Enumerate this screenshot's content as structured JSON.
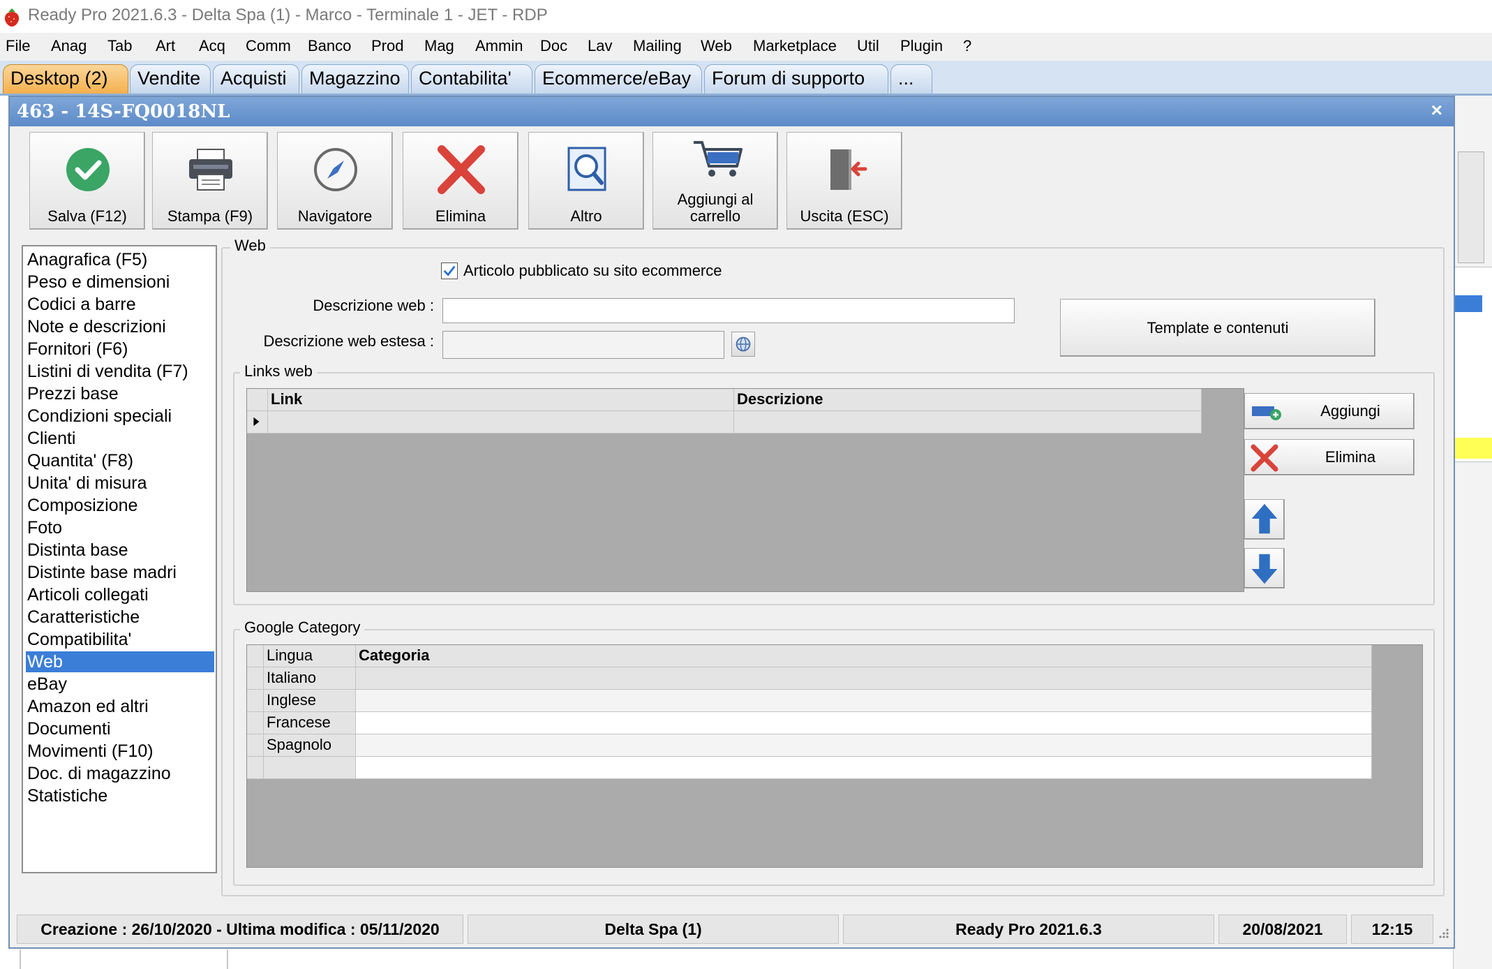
{
  "window_title": "Ready Pro 2021.6.3 - Delta Spa (1) - Marco - Terminale 1 - JET - RDP",
  "menu": [
    "File",
    "Anag",
    "Tab",
    "Art",
    "Acq",
    "Comm",
    "Banco",
    "Prod",
    "Mag",
    "Ammin",
    "Doc",
    "Lav",
    "Mailing",
    "Web",
    "Marketplace",
    "Util",
    "Plugin",
    "?"
  ],
  "tabs": [
    {
      "label": "Desktop (2)",
      "active": true
    },
    {
      "label": "Vendite"
    },
    {
      "label": "Acquisti"
    },
    {
      "label": "Magazzino"
    },
    {
      "label": "Contabilita'"
    },
    {
      "label": "Ecommerce/eBay"
    },
    {
      "label": "Forum di supporto"
    },
    {
      "label": "..."
    }
  ],
  "dialog": {
    "title": "463 - 14S-FQ0018NL",
    "close": "×"
  },
  "toolbar": {
    "save": "Salva (F12)",
    "print": "Stampa (F9)",
    "navigator": "Navigatore",
    "delete": "Elimina",
    "other": "Altro",
    "add_cart_1": "Aggiungi al",
    "add_cart_2": "carrello",
    "exit": "Uscita (ESC)"
  },
  "nav": {
    "items": [
      "Anagrafica (F5)",
      "Peso e dimensioni",
      "Codici a barre",
      "Note e descrizioni",
      "Fornitori (F6)",
      "Listini di vendita (F7)",
      "Prezzi base",
      "Condizioni speciali",
      "Clienti",
      "Quantita' (F8)",
      "Unita' di misura",
      "Composizione",
      "Foto",
      "Distinta base",
      "Distinte base madri",
      "Articoli collegati",
      "Caratteristiche",
      "Compatibilita'",
      "Web",
      "eBay",
      "Amazon ed altri",
      "Documenti",
      "Movimenti (F10)",
      "Doc. di magazzino",
      "Statistiche"
    ],
    "selected": "Web"
  },
  "web": {
    "group_label": "Web",
    "published_label": "Articolo pubblicato su sito ecommerce",
    "published_checked": true,
    "desc_label": "Descrizione web :",
    "desc_value": "",
    "desc_ext_label": "Descrizione web estesa :",
    "desc_ext_value": "",
    "template_button": "Template e contenuti"
  },
  "links": {
    "group_label": "Links web",
    "col_link": "Link",
    "col_desc": "Descrizione",
    "add_button": "Aggiungi",
    "delete_button": "Elimina"
  },
  "google": {
    "group_label": "Google Category",
    "col_lang": "Lingua",
    "col_cat": "Categoria",
    "rows": [
      "Italiano",
      "Inglese",
      "Francese",
      "Spagnolo"
    ]
  },
  "status": {
    "created": "Creazione : 26/10/2020 - Ultima modifica : 05/11/2020",
    "company": "Delta Spa (1)",
    "version": "Ready Pro 2021.6.3",
    "date": "20/08/2021",
    "time": "12:15"
  },
  "colors": {
    "accent": "#3b7ed8",
    "title_bar": "#5d8bc8",
    "active_tab": "#f4b04d",
    "delete_red": "#d9433a",
    "save_green": "#3aa565"
  },
  "icons": {
    "save": "check-circle-icon",
    "print": "printer-icon",
    "navigator": "compass-icon",
    "delete": "x-icon",
    "other": "magnifier-icon",
    "cart": "cart-icon",
    "exit": "exit-door-icon"
  }
}
